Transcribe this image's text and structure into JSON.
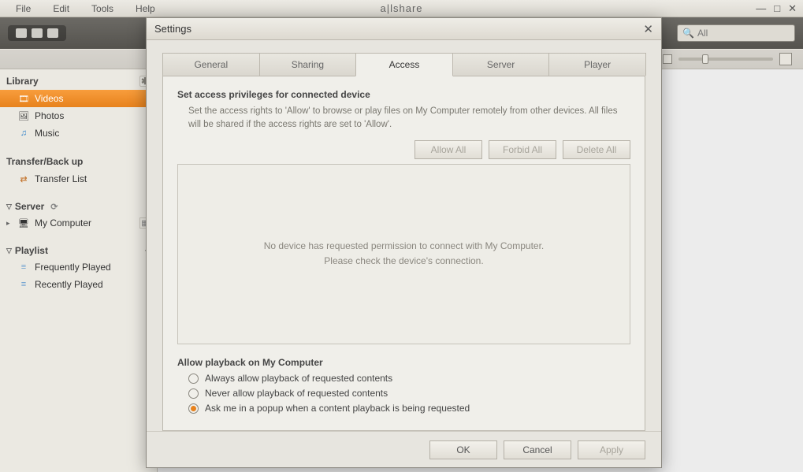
{
  "menubar": {
    "items": [
      "File",
      "Edit",
      "Tools",
      "Help"
    ],
    "app_title": "a|lshare"
  },
  "toolbar": {
    "search_placeholder": "All"
  },
  "sidebar": {
    "library_label": "Library",
    "library_items": [
      {
        "label": "Videos",
        "selected": true
      },
      {
        "label": "Photos",
        "selected": false
      },
      {
        "label": "Music",
        "selected": false
      }
    ],
    "transfer_label": "Transfer/Back up",
    "transfer_item": "Transfer List",
    "server_label": "Server",
    "server_item": "My Computer",
    "playlist_label": "Playlist",
    "playlist_items": [
      "Frequently Played",
      "Recently Played"
    ]
  },
  "dialog": {
    "title": "Settings",
    "tabs": [
      "General",
      "Sharing",
      "Access",
      "Server",
      "Player"
    ],
    "active_tab": "Access",
    "access": {
      "section_title": "Set access privileges for connected device",
      "section_desc": "Set the access rights to 'Allow' to browse or play files on My Computer remotely from other devices. All files will be shared if the access rights are set to 'Allow'.",
      "allow_all": "Allow All",
      "forbid_all": "Forbid All",
      "delete_all": "Delete All",
      "empty_line1": "No device has requested permission to connect with My Computer.",
      "empty_line2": "Please check the device's connection.",
      "playback_title": "Allow playback on My Computer",
      "radio_options": [
        "Always allow playback of requested contents",
        "Never allow playback of requested contents",
        "Ask me in a popup when a content playback is being requested"
      ],
      "radio_selected": 2
    },
    "buttons": {
      "ok": "OK",
      "cancel": "Cancel",
      "apply": "Apply"
    }
  }
}
